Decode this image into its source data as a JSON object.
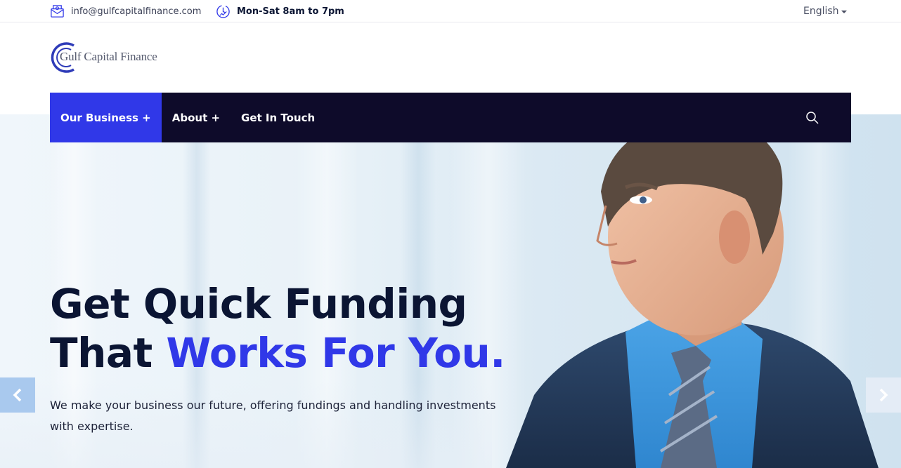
{
  "topbar": {
    "email": "info@gulfcapitalfinance.com",
    "hours": "Mon-Sat 8am to 7pm",
    "language": "English",
    "icons": {
      "email": "envelope-icon",
      "hours": "clock-icon",
      "language": "caret-down-icon"
    }
  },
  "logo": {
    "text": "Gulf Capital Finance"
  },
  "nav": {
    "items": [
      {
        "label": "Our Business +"
      },
      {
        "label": "About +"
      },
      {
        "label": "Get In Touch"
      }
    ],
    "search_icon": "search-icon"
  },
  "hero": {
    "headline_line1": "Get Quick Funding",
    "headline_line2_plain": "That ",
    "headline_line2_accent": "Works For You.",
    "subtitle": "We make your business our future, offering fundings and handling investments with expertise."
  },
  "slider": {
    "prev_icon": "chevron-left-icon",
    "next_icon": "chevron-right-icon"
  },
  "colors": {
    "accent": "#3038e8",
    "nav_bg": "#0e0b2a",
    "headline": "#0b1533"
  }
}
